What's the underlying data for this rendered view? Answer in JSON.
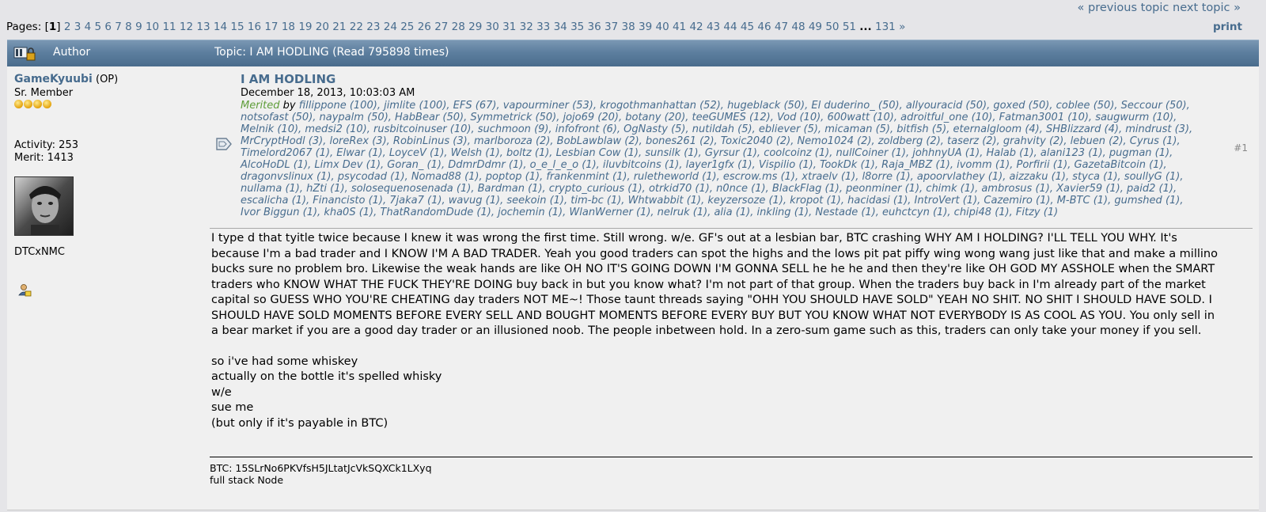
{
  "nav": {
    "prev": "« previous topic",
    "next": "next topic »"
  },
  "pagination": {
    "label": "Pages:",
    "current": "1",
    "pages": [
      "2",
      "3",
      "4",
      "5",
      "6",
      "7",
      "8",
      "9",
      "10",
      "11",
      "12",
      "13",
      "14",
      "15",
      "16",
      "17",
      "18",
      "19",
      "20",
      "21",
      "22",
      "23",
      "24",
      "25",
      "26",
      "27",
      "28",
      "29",
      "30",
      "31",
      "32",
      "33",
      "34",
      "35",
      "36",
      "37",
      "38",
      "39",
      "40",
      "41",
      "42",
      "43",
      "44",
      "45",
      "46",
      "47",
      "48",
      "49",
      "50",
      "51"
    ],
    "ellipsis": "...",
    "last": "131",
    "next": "»",
    "print": "print"
  },
  "header": {
    "author": "Author",
    "topic": "Topic: I AM HODLING  (Read 795898 times)"
  },
  "poster": {
    "name": "GameKyuubi",
    "op": "(OP)",
    "rank": "Sr. Member",
    "stars": 4,
    "activity": "Activity: 253",
    "merit": "Merit: 1413",
    "personal_text": "DTCxNMC"
  },
  "post": {
    "subject": "I AM HODLING",
    "date": "December 18, 2013, 10:03:03 AM",
    "merited_label": "Merited",
    "merited_by": "by",
    "number": "#1",
    "merits": [
      [
        "fillippone",
        "(100)"
      ],
      [
        "jimlite",
        "(100)"
      ],
      [
        "EFS",
        "(67)"
      ],
      [
        "vapourminer",
        "(53)"
      ],
      [
        "krogothmanhattan",
        "(52)"
      ],
      [
        "hugeblack",
        "(50)"
      ],
      [
        "El duderino_",
        "(50)"
      ],
      [
        "allyouracid",
        "(50)"
      ],
      [
        "goxed",
        "(50)"
      ],
      [
        "coblee",
        "(50)"
      ],
      [
        "Seccour",
        "(50)"
      ],
      [
        "notsofast",
        "(50)"
      ],
      [
        "naypalm",
        "(50)"
      ],
      [
        "HabBear",
        "(50)"
      ],
      [
        "Symmetrick",
        "(50)"
      ],
      [
        "jojo69",
        "(20)"
      ],
      [
        "botany",
        "(20)"
      ],
      [
        "teeGUMES",
        "(12)"
      ],
      [
        "Vod",
        "(10)"
      ],
      [
        "600watt",
        "(10)"
      ],
      [
        "adroitful_one",
        "(10)"
      ],
      [
        "Fatman3001",
        "(10)"
      ],
      [
        "saugwurm",
        "(10)"
      ],
      [
        "Melnik",
        "(10)"
      ],
      [
        "medsi2",
        "(10)"
      ],
      [
        "rusbitcoinuser",
        "(10)"
      ],
      [
        "suchmoon",
        "(9)"
      ],
      [
        "infofront",
        "(6)"
      ],
      [
        "OgNasty",
        "(5)"
      ],
      [
        "nutildah",
        "(5)"
      ],
      [
        "ebliever",
        "(5)"
      ],
      [
        "micaman",
        "(5)"
      ],
      [
        "bitfish",
        "(5)"
      ],
      [
        "eternalgloom",
        "(4)"
      ],
      [
        "SHBlizzard",
        "(4)"
      ],
      [
        "mindrust",
        "(3)"
      ],
      [
        "MrCryptHodl",
        "(3)"
      ],
      [
        "loreRex",
        "(3)"
      ],
      [
        "RobinLinus",
        "(3)"
      ],
      [
        "marlboroza",
        "(2)"
      ],
      [
        "BobLawblaw",
        "(2)"
      ],
      [
        "bones261",
        "(2)"
      ],
      [
        "Toxic2040",
        "(2)"
      ],
      [
        "Nemo1024",
        "(2)"
      ],
      [
        "zoldberg",
        "(2)"
      ],
      [
        "taserz",
        "(2)"
      ],
      [
        "grahvity",
        "(2)"
      ],
      [
        "lebuen",
        "(2)"
      ],
      [
        "Cyrus",
        "(1)"
      ],
      [
        "Timelord2067",
        "(1)"
      ],
      [
        "Elwar",
        "(1)"
      ],
      [
        "LoyceV",
        "(1)"
      ],
      [
        "Welsh",
        "(1)"
      ],
      [
        "boltz",
        "(1)"
      ],
      [
        "Lesbian Cow",
        "(1)"
      ],
      [
        "sunsilk",
        "(1)"
      ],
      [
        "Gyrsur",
        "(1)"
      ],
      [
        "coolcoinz",
        "(1)"
      ],
      [
        "nullCoiner",
        "(1)"
      ],
      [
        "johhnyUA",
        "(1)"
      ],
      [
        "Halab",
        "(1)"
      ],
      [
        "alani123",
        "(1)"
      ],
      [
        "pugman",
        "(1)"
      ],
      [
        "AlcoHoDL",
        "(1)"
      ],
      [
        "Limx Dev",
        "(1)"
      ],
      [
        "Goran_",
        "(1)"
      ],
      [
        "DdmrDdmr",
        "(1)"
      ],
      [
        "o_e_l_e_o",
        "(1)"
      ],
      [
        "iluvbitcoins",
        "(1)"
      ],
      [
        "layer1gfx",
        "(1)"
      ],
      [
        "Vispilio",
        "(1)"
      ],
      [
        "TookDk",
        "(1)"
      ],
      [
        "Raja_MBZ",
        "(1)"
      ],
      [
        "ivomm",
        "(1)"
      ],
      [
        "Porfirii",
        "(1)"
      ],
      [
        "GazetaBitcoin",
        "(1)"
      ],
      [
        "dragonvslinux",
        "(1)"
      ],
      [
        "psycodad",
        "(1)"
      ],
      [
        "Nomad88",
        "(1)"
      ],
      [
        "poptop",
        "(1)"
      ],
      [
        "frankenmint",
        "(1)"
      ],
      [
        "ruletheworld",
        "(1)"
      ],
      [
        "escrow.ms",
        "(1)"
      ],
      [
        "xtraelv",
        "(1)"
      ],
      [
        "l8orre",
        "(1)"
      ],
      [
        "apoorvlathey",
        "(1)"
      ],
      [
        "aizzaku",
        "(1)"
      ],
      [
        "styca",
        "(1)"
      ],
      [
        "soullyG",
        "(1)"
      ],
      [
        "nullama",
        "(1)"
      ],
      [
        "hZti",
        "(1)"
      ],
      [
        "solosequenosenada",
        "(1)"
      ],
      [
        "Bardman",
        "(1)"
      ],
      [
        "crypto_curious",
        "(1)"
      ],
      [
        "otrkid70",
        "(1)"
      ],
      [
        "n0nce",
        "(1)"
      ],
      [
        "BlackFlag",
        "(1)"
      ],
      [
        "peonminer",
        "(1)"
      ],
      [
        "chimk",
        "(1)"
      ],
      [
        "ambrosus",
        "(1)"
      ],
      [
        "Xavier59",
        "(1)"
      ],
      [
        "paid2",
        "(1)"
      ],
      [
        "escalicha",
        "(1)"
      ],
      [
        "Financisto",
        "(1)"
      ],
      [
        "7jaka7",
        "(1)"
      ],
      [
        "wavug",
        "(1)"
      ],
      [
        "seekoin",
        "(1)"
      ],
      [
        "tim-bc",
        "(1)"
      ],
      [
        "Whtwabbit",
        "(1)"
      ],
      [
        "keyzersoze",
        "(1)"
      ],
      [
        "kropot",
        "(1)"
      ],
      [
        "hacidasi",
        "(1)"
      ],
      [
        "IntroVert",
        "(1)"
      ],
      [
        "Cazemiro",
        "(1)"
      ],
      [
        "M-BTC",
        "(1)"
      ],
      [
        "gumshed",
        "(1)"
      ],
      [
        "Ivor Biggun",
        "(1)"
      ],
      [
        "kha0S",
        "(1)"
      ],
      [
        "ThatRandomDude",
        "(1)"
      ],
      [
        "jochemin",
        "(1)"
      ],
      [
        "WlanWerner",
        "(1)"
      ],
      [
        "nelruk",
        "(1)"
      ],
      [
        "alia",
        "(1)"
      ],
      [
        "inkling",
        "(1)"
      ],
      [
        "Nestade",
        "(1)"
      ],
      [
        "euhctcyn",
        "(1)"
      ],
      [
        "chipi48",
        "(1)"
      ],
      [
        "Fitzy",
        "(1)"
      ]
    ],
    "body_paragraph": "I type d that tyitle twice because I knew it was wrong the first time.  Still wrong.  w/e.  GF's out at a lesbian bar, BTC crashing WHY AM I HOLDING? I'LL TELL YOU WHY.  It's because I'm a bad trader and I KNOW I'M A BAD TRADER.  Yeah you good traders can spot the highs and the lows pit pat piffy wing wong wang just like that and make a millino bucks sure no problem bro.  Likewise the weak hands are like OH NO IT'S GOING DOWN I'M GONNA SELL he he he and then they're like OH GOD MY ASSHOLE when the SMART traders who KNOW WHAT THE FUCK THEY'RE DOING buy back in but you know what?  I'm not part of that group.  When the traders buy back in I'm already part of the market capital so GUESS WHO YOU'RE CHEATING day traders NOT ME~!  Those taunt threads saying \"OHH YOU SHOULD HAVE SOLD\" YEAH NO SHIT.  NO SHIT I SHOULD HAVE SOLD.  I SHOULD HAVE SOLD MOMENTS BEFORE EVERY SELL AND BOUGHT MOMENTS BEFORE EVERY BUY BUT YOU KNOW WHAT NOT EVERYBODY IS AS COOL AS YOU.  You only sell in a bear market if you are a good day trader or an illusioned noob.  The people inbetween hold.  In a zero-sum game such as this, traders can only take your money if you sell.",
    "body_lines": [
      "so i've had some whiskey",
      "actually on the bottle it's spelled whisky",
      "w/e",
      "sue me",
      "(but only if it's payable in BTC)"
    ]
  },
  "signature": {
    "btc": "BTC: 15SLrNo6PKVfsH5JLtatJcVkSQXCk1LXyq",
    "line2": "full stack Node"
  },
  "colors": {
    "link": "#476c8e",
    "merited": "#5e9d39",
    "header_bar": "#5d7f9f"
  }
}
